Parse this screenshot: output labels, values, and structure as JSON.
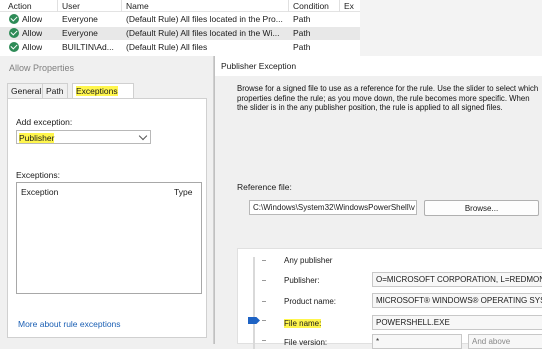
{
  "rules_table": {
    "headers": [
      "Action",
      "User",
      "Name",
      "Condition",
      "Ex"
    ],
    "rows": [
      {
        "action": "Allow",
        "user": "Everyone",
        "name": "(Default Rule) All files located in the Pro...",
        "condition": "Path"
      },
      {
        "action": "Allow",
        "user": "Everyone",
        "name": "(Default Rule) All files located in the Wi...",
        "condition": "Path"
      },
      {
        "action": "Allow",
        "user": "BUILTIN\\Ad...",
        "name": "(Default Rule) All files",
        "condition": "Path"
      }
    ]
  },
  "allow_properties": {
    "title": "Allow Properties",
    "tabs": [
      "General",
      "Path",
      "Exceptions"
    ],
    "active_tab": "Exceptions",
    "add_exception_label": "Add exception:",
    "add_exception_value": "Publisher",
    "exceptions_label": "Exceptions:",
    "columns": [
      "Exception",
      "Type"
    ],
    "more_link": "More about rule exceptions"
  },
  "publisher_exception": {
    "title": "Publisher Exception",
    "description": "Browse for a signed file to use as a reference for the rule. Use the slider to select which properties define the rule; as you move down, the rule becomes more specific. When the slider is in the any publisher position, the rule is applied to all signed files.",
    "reference_label": "Reference file:",
    "reference_value": "C:\\Windows\\System32\\WindowsPowerShell\\v",
    "browse_label": "Browse...",
    "levels": [
      {
        "label": "Any publisher",
        "value": ""
      },
      {
        "label": "Publisher:",
        "value": "O=MICROSOFT CORPORATION, L=REDMOND"
      },
      {
        "label": "Product name:",
        "value": "MICROSOFT® WINDOWS® OPERATING SYST"
      },
      {
        "label": "File name:",
        "value": "POWERSHELL.EXE"
      },
      {
        "label": "File version:",
        "value": "*"
      }
    ],
    "selected_level": "File name:",
    "version_option": "And above"
  }
}
